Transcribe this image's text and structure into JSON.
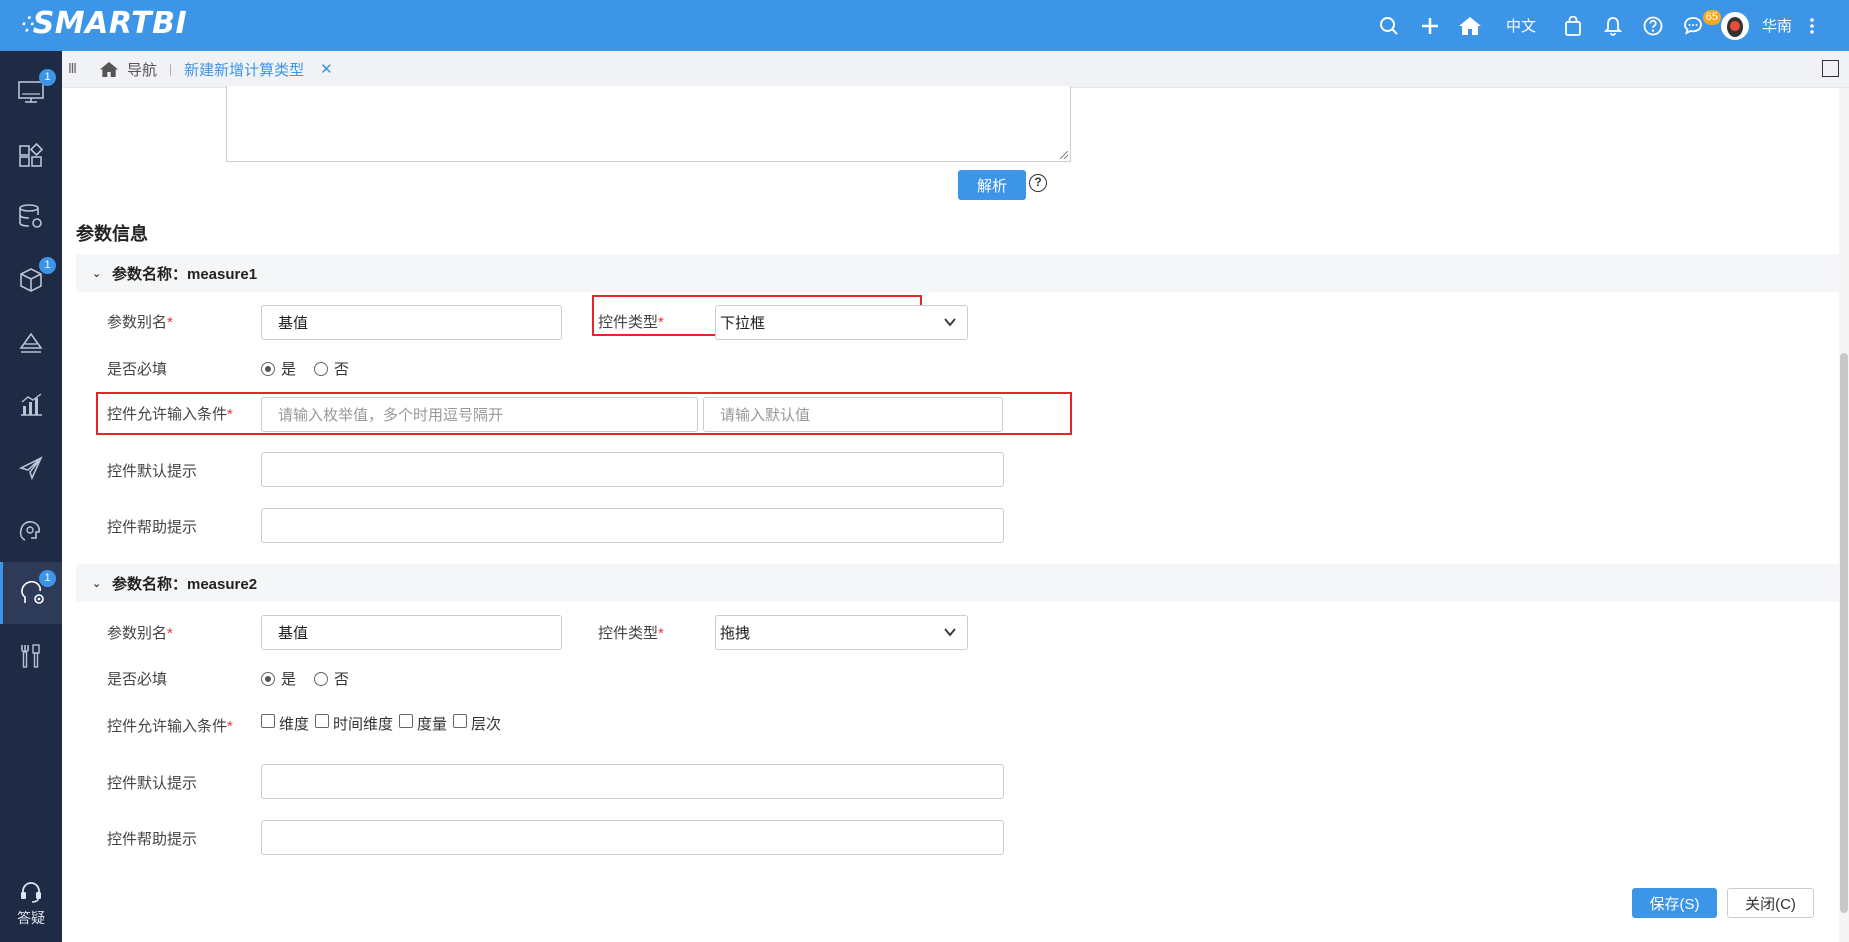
{
  "app": {
    "logo_text": "SMARTBI"
  },
  "topbar": {
    "lang": "中文",
    "chat_badge": "65",
    "user_name": "华南"
  },
  "sidebar": {
    "badges": {
      "monitor": "1",
      "model": "1",
      "active": "1"
    },
    "help_label": "答疑"
  },
  "tabbar": {
    "nav_label": "导航",
    "active_tab": "新建新增计算类型",
    "close_glyph": "✕"
  },
  "form": {
    "parse_button": "解析",
    "help_glyph": "?",
    "section_title": "参数信息",
    "groups": [
      {
        "header": "参数名称：measure1",
        "alias_label": "参数别名",
        "alias_value": "基值",
        "control_type_label": "控件类型",
        "control_type_value": "下拉框",
        "required_label": "是否必填",
        "yes": "是",
        "no": "否",
        "condition_label": "控件允许输入条件",
        "enum_placeholder": "请输入枚举值，多个时用逗号隔开",
        "default_placeholder": "请输入默认值",
        "default_hint_label": "控件默认提示",
        "help_hint_label": "控件帮助提示"
      },
      {
        "header": "参数名称：measure2",
        "alias_label": "参数别名",
        "alias_value": "基值",
        "control_type_label": "控件类型",
        "control_type_value": "拖拽",
        "required_label": "是否必填",
        "yes": "是",
        "no": "否",
        "condition_label": "控件允许输入条件",
        "checkbox_options": [
          "维度",
          "时间维度",
          "度量",
          "层次"
        ],
        "default_hint_label": "控件默认提示",
        "help_hint_label": "控件帮助提示"
      }
    ],
    "required_mark": "*",
    "save_button": "保存(S)",
    "close_button": "关闭(C)"
  },
  "colors": {
    "primary": "#3d95e8",
    "sidebar": "#1f2a44",
    "highlight": "#e5252a"
  }
}
